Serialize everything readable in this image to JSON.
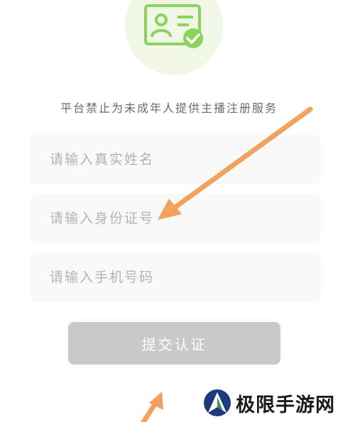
{
  "notice": "平台禁止为未成年人提供主播注册服务",
  "fields": {
    "name_placeholder": "请输入真实姓名",
    "idcard_placeholder": "请输入身份证号",
    "phone_placeholder": "请输入手机号码"
  },
  "submit_label": "提交认证",
  "watermark": "极限手游网",
  "icons": {
    "badge": "id-card-verified-icon",
    "watermark_logo": "site-logo-icon"
  },
  "colors": {
    "accent_green": "#8cd35b",
    "badge_background": "#f0f7e6",
    "field_background": "#f9f9f9",
    "placeholder": "#b3b3b3",
    "button_disabled": "#c9c9c9",
    "annotation_arrow": "#f5a15e",
    "logo_navy": "#1f3a7a"
  }
}
